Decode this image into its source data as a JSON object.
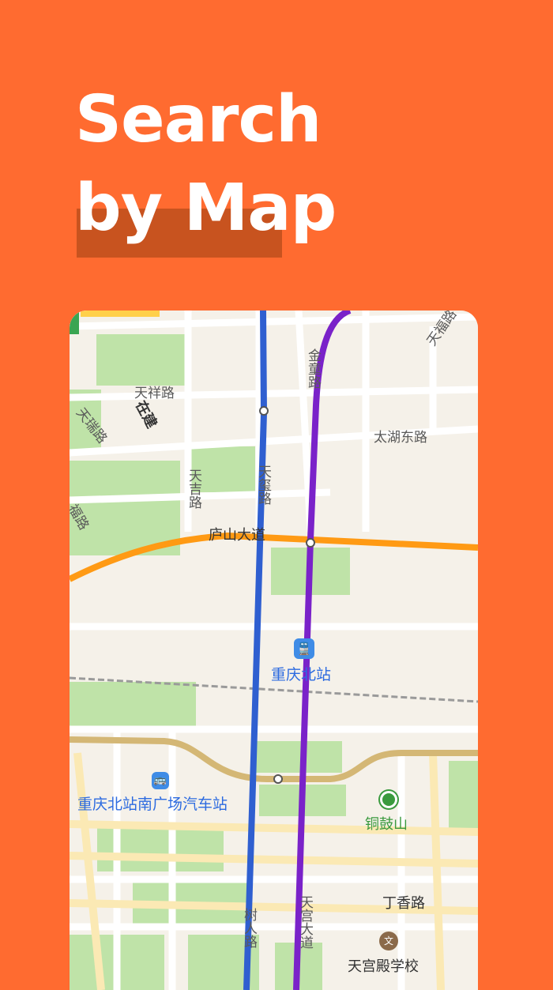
{
  "headline": {
    "line1": "Search",
    "line2": "by Map"
  },
  "map": {
    "stations": {
      "chongqing_north": "重庆北站",
      "bus_station": "重庆北站南广场汽车站",
      "tonggu_mountain": "铜鼓山",
      "tiangong_school": "天宫殿学校"
    },
    "roads": {
      "tianfu": "天福路",
      "tianxiang": "天祥路",
      "jintong": "金童路",
      "zaijian": "在建",
      "tianrui": "天瑞路",
      "taihu_east": "太湖东路",
      "tianji": "天吉路",
      "tianxi": "天玺路",
      "lushan": "庐山大道",
      "fu": "福路",
      "dingxiang": "丁香路",
      "shushi": "树人路",
      "tiangong": "天宫大道"
    },
    "colors": {
      "line_blue": "#2F5FD0",
      "line_purple": "#7A22C9",
      "line_orange": "#FF9A14",
      "line_tan": "#D4B775",
      "green_area": "#BFE3A8"
    }
  }
}
